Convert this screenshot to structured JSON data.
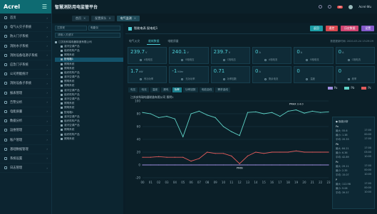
{
  "brand": {
    "logo": "Acrel"
  },
  "platform_title": "智慧消防用电监管平台",
  "topbar": {
    "notifications": "99",
    "user": "Acrel-Wu"
  },
  "tabs": [
    {
      "label": "首页",
      "active": false
    },
    {
      "label": "配置探头",
      "active": false
    },
    {
      "label": "电气监测",
      "active": true
    }
  ],
  "nav": [
    "首页",
    "电气火灾子系统",
    "防火门子系统",
    "消防水子系统",
    "消防设备电源子系统",
    "应急门子系统",
    "公司用能统计",
    "消防设备子系统",
    "报表管理",
    "告警分析",
    "电能质量",
    "数据分析",
    "运维管理",
    "账户管理",
    "基础数据管理",
    "系统设置",
    "日志管理"
  ],
  "tree": {
    "filters": [
      "江苏安",
      "电能仪"
    ],
    "search_placeholder": "请输入关键字",
    "items": [
      "江苏安科瑞电器制造有限公司",
      "液冷空调产品",
      "组织机构产品",
      "照明系统",
      "配电箱1",
      "照明系统",
      "照明系统",
      "组织机构产品",
      "液冷空调产品",
      "照明系统",
      "照明系统",
      "液冷空调产品",
      "组织机构产品",
      "液冷空调产品",
      "照明系统",
      "照明系统",
      "配电箱1",
      "液冷空调产品",
      "组织机构产品",
      "液冷空调产品",
      "照明系统",
      "组织机构产品",
      "照明系统"
    ],
    "selected_index": 4
  },
  "device": {
    "name": "智能电表 配电柜1",
    "buttons": [
      "返回",
      "遥控",
      "历史数据",
      "设置"
    ]
  },
  "sub_tabs": [
    "电气火灾",
    "能耗数据",
    "电能质量"
  ],
  "sub_tab_active": 1,
  "update_time": "数据更新时间: 2020-03-24 13:29:29",
  "metrics": [
    {
      "value": "239.7",
      "unit": "V",
      "label": "A相电压"
    },
    {
      "value": "240.1",
      "unit": "V",
      "label": "B相电压"
    },
    {
      "value": "239.7",
      "unit": "V",
      "label": "C相电压"
    },
    {
      "value": "0",
      "unit": "A",
      "label": "A相电流"
    },
    {
      "value": "0",
      "unit": "A",
      "label": "B相电流"
    },
    {
      "value": "0",
      "unit": "A",
      "label": "C相电流"
    },
    {
      "value": "1.7",
      "unit": "kW",
      "label": "有功功率"
    },
    {
      "value": "-1",
      "unit": "kVar",
      "label": "无功功率"
    },
    {
      "value": "0.71",
      "unit": "",
      "label": "功率因数"
    },
    {
      "value": "0",
      "unit": "A",
      "label": "剩余电流"
    },
    {
      "value": "0",
      "unit": "",
      "label": "温度"
    },
    {
      "value": "0",
      "unit": "",
      "label": "频率"
    }
  ],
  "chart_tabs": [
    "电压",
    "电流",
    "温度",
    "漏电",
    "功率",
    "功率因数",
    "电能曲线",
    "需求曲线"
  ],
  "chart_tab_active": 4,
  "chart_data": {
    "type": "line",
    "title": "江苏安科瑞电器制造有限公司 照明1",
    "x": [
      "00",
      "01",
      "02",
      "03",
      "04",
      "05",
      "06",
      "07",
      "08",
      "09",
      "10",
      "11",
      "12",
      "13",
      "14",
      "15",
      "16",
      "17",
      "18",
      "19",
      "20",
      "21",
      "22",
      "23"
    ],
    "ylim": [
      -20,
      100
    ],
    "yticks": [
      100,
      80,
      60,
      40,
      20,
      0,
      -20
    ],
    "series": [
      {
        "name": "Pa",
        "color": "#9f8ee0",
        "values": [
          0,
          0,
          0,
          0,
          0,
          0,
          0,
          0,
          0,
          0,
          0,
          0,
          0,
          0,
          0,
          0,
          0,
          0,
          0,
          0,
          0,
          0,
          0,
          0
        ]
      },
      {
        "name": "Pb",
        "color": "#5fd3c7",
        "values": [
          82,
          80,
          74,
          76,
          72,
          44,
          80,
          84,
          78,
          74,
          60,
          52,
          46,
          82,
          83,
          80,
          82,
          76,
          84,
          86,
          81,
          84,
          82,
          83
        ]
      },
      {
        "name": "Pc",
        "color": "#e25b5b",
        "values": [
          12,
          12,
          13,
          12,
          12,
          12,
          6,
          10,
          20,
          18,
          18,
          14,
          2,
          14,
          20,
          18,
          20,
          20,
          20,
          22,
          20,
          20,
          20,
          20
        ]
      }
    ],
    "tooltip": "PMAX 3.4.0",
    "min_label": "PMIN",
    "legend_pos": "top-right"
  },
  "info_panel": {
    "title": "● 极值分析",
    "groups": [
      {
        "head": "Pa",
        "lines": [
          [
            "最大: 55.6",
            "17:00"
          ],
          [
            "最小: 1.38",
            "00:00"
          ],
          [
            "平均: 20.33",
            "17:00"
          ]
        ]
      },
      {
        "head": "Pb",
        "lines": [
          [
            "最大: 84.21",
            "17:00"
          ],
          [
            "最小: 6.36",
            "03:00"
          ],
          [
            "平均: 42.89",
            "10:00"
          ]
        ]
      },
      {
        "head": "Pc",
        "lines": [
          [
            "最大: 29.11",
            "17:00"
          ],
          [
            "最小: 2.35",
            "00:00"
          ],
          [
            "平均: 15.07",
            "10:00"
          ]
        ]
      },
      {
        "head": "P",
        "lines": [
          [
            "最大: 112.98",
            "17:00"
          ],
          [
            "最小: 9.08",
            "00:00"
          ],
          [
            "平均: 39.57",
            "10:00"
          ]
        ]
      }
    ]
  }
}
